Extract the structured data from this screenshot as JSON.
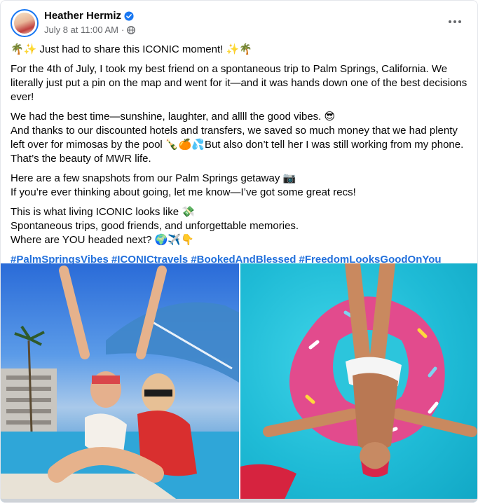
{
  "post": {
    "author_name": "Heather Hermiz",
    "timestamp": "July 8 at 11:00 AM",
    "separator": "·",
    "audience_icon": "globe-icon",
    "verified_icon": "verified-badge-icon",
    "more_icon": "more-options-icon"
  },
  "content": {
    "line1": "🌴✨ Just had to share this ICONIC moment! ✨🌴",
    "para2": "For the 4th of July, I took my best friend on a spontaneous trip to Palm Springs, California. We literally just put a pin on the map and went for it—and it was hands down one of the best decisions ever!",
    "para3a": "We had the best time—sunshine, laughter, and allll the good vibes. 😎",
    "para3b": "And thanks to our discounted hotels and transfers, we saved so much money that we had plenty left over for mimosas by the pool 🍾🍊💦But also don’t tell her I was still working from my phone. That’s the beauty of MWR life.",
    "para4a": "Here are a few snapshots from our Palm Springs getaway 📷",
    "para4b": "If you’re ever thinking about going, let me know—I’ve got some great recs!",
    "para5a": "This is what living ICONIC looks like 💸",
    "para5b": "Spontaneous trips, good friends, and unforgettable memories.",
    "para5c": "Where are YOU headed next? 🌍✈️👇",
    "hashtags": "#PalmSpringsVibes #ICONICtravels #BookedAndBlessed #FreedomLooksGoodOnYou"
  },
  "colors": {
    "brand_blue": "#1877f2",
    "hashtag": "#216fdb",
    "meta_text": "#65676b",
    "text": "#050505"
  }
}
